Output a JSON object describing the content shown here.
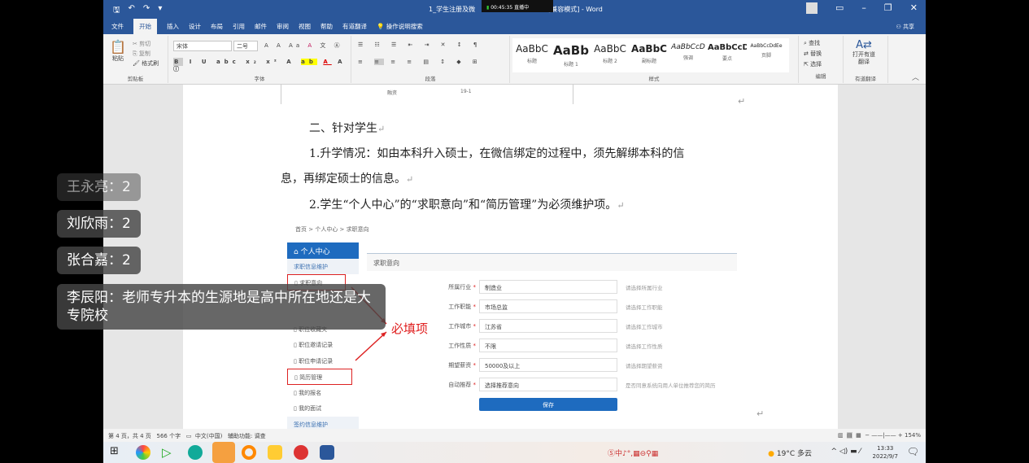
{
  "window": {
    "title": "1_学生注册及微",
    "title_suffix": "[兼容模式] - Word",
    "recording": "00:45:35 直播中",
    "share": "共享"
  },
  "tabs": [
    "文件",
    "开始",
    "插入",
    "设计",
    "布局",
    "引用",
    "邮件",
    "审阅",
    "视图",
    "帮助",
    "有道翻译",
    "操作说明搜索"
  ],
  "ribbon": {
    "clipboard": {
      "paste": "粘贴",
      "cut": "剪切",
      "copy": "复制",
      "format_painter": "格式刷",
      "label": "剪贴板"
    },
    "font": {
      "name": "宋体",
      "size": "二号",
      "label": "字体"
    },
    "paragraph": {
      "label": "段落"
    },
    "styles": {
      "label": "样式",
      "items": [
        {
          "sample": "AaBbC",
          "name": "标题"
        },
        {
          "sample": "AaBb",
          "name": "标题 1"
        },
        {
          "sample": "AaBbC",
          "name": "标题 2"
        },
        {
          "sample": "AaBbC",
          "name": "副标题"
        },
        {
          "sample": "AaBbCcD",
          "name": "强调"
        },
        {
          "sample": "AaBbCcD",
          "name": "要点"
        },
        {
          "sample": "AaBbCcDdEe",
          "name": "页脚"
        }
      ]
    },
    "editing": {
      "find": "查找",
      "replace": "替换",
      "select": "选择",
      "label": "编辑"
    },
    "translate": {
      "open": "打开有道翻译",
      "label": "有道翻译"
    }
  },
  "document": {
    "table_fragment": [
      "融资",
      "19-1"
    ],
    "heading": "二、针对学生",
    "p1_line1": "1.升学情况：如由本科升入硕士，在微信绑定的过程中，须先解绑本科的信",
    "p1_line2": "息，再绑定硕士的信息。",
    "p2": "2.学生“个人中心”的“求职意向”和“简历管理”为必须维护项。",
    "para_mark": "↵"
  },
  "screenshot": {
    "breadcrumb": "首页 > 个人中心 > 求职意向",
    "nav_header": "个人中心",
    "nav_section1": "求职信息维护",
    "nav_items": [
      "求职意向",
      "职位收藏夹",
      "职位邀请记录",
      "职位申请记录",
      "简历管理",
      "我的报名",
      "我的面试"
    ],
    "nav_section2": "签约信息维护",
    "form_title": "求职意向",
    "fields": [
      {
        "label": "所属行业",
        "value": "制造业",
        "hint": "请选择所属行业"
      },
      {
        "label": "工作职能",
        "value": "市场总监",
        "hint": "请选择工作职能"
      },
      {
        "label": "工作城市",
        "value": "江苏省",
        "hint": "请选择工作城市"
      },
      {
        "label": "工作性质",
        "value": "不限",
        "hint": "请选择工作性质"
      },
      {
        "label": "期望薪资",
        "value": "50000及以上",
        "hint": "请选择期望薪资"
      },
      {
        "label": "自动推荐",
        "value": "选择推荐意向",
        "hint": "是否同意系统向用人单位推荐您的简历"
      }
    ],
    "required_mark": "*",
    "save": "保存",
    "annotation": "必填项"
  },
  "statusbar": {
    "page": "第 4 页，共 4 页",
    "words": "566 个字",
    "lang": "中文(中国)",
    "accessibility": "辅助功能: 调查",
    "zoom": "154%"
  },
  "taskbar": {
    "weather": "19°C 多云",
    "time": "13:33",
    "date": "2022/9/7"
  },
  "chat": [
    {
      "text": "王永亮：2"
    },
    {
      "text": "刘欣雨：2"
    },
    {
      "text": "张合嘉：2"
    },
    {
      "text": "李辰阳：老师专升本的生源地是高中所在地还是大专院校"
    }
  ]
}
